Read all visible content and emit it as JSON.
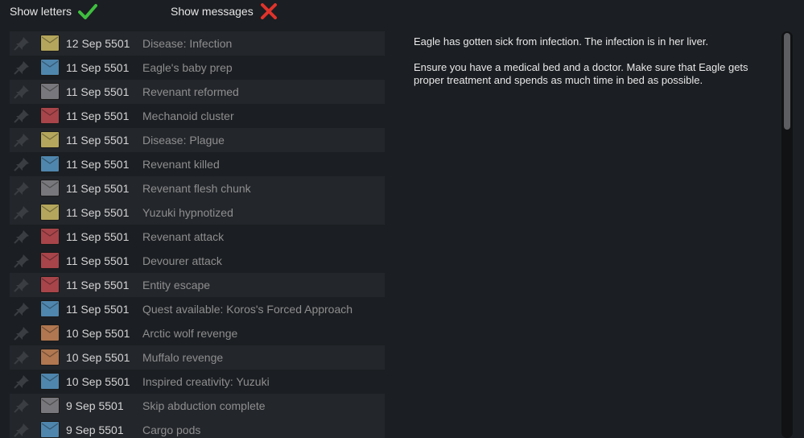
{
  "toggles": {
    "letters": {
      "label": "Show letters",
      "state": "on",
      "icon": "check-icon",
      "color": "#3fbf3f"
    },
    "messages": {
      "label": "Show messages",
      "state": "off",
      "icon": "cross-icon",
      "color": "#e0332b"
    }
  },
  "envelope_colors": {
    "yellow": "#b4a65c",
    "blue": "#4f86ad",
    "gray": "#78787c",
    "red": "#a8454a",
    "orange": "#b07750"
  },
  "letters": [
    {
      "date": "12 Sep 5501",
      "label": "Disease: Infection",
      "color": "yellow",
      "icon": "pin-icon"
    },
    {
      "date": "11 Sep 5501",
      "label": "Eagle's baby prep",
      "color": "blue",
      "icon": "pin-icon"
    },
    {
      "date": "11 Sep 5501",
      "label": "Revenant reformed",
      "color": "gray",
      "icon": "pin-icon"
    },
    {
      "date": "11 Sep 5501",
      "label": "Mechanoid cluster",
      "color": "red",
      "icon": "pin-icon"
    },
    {
      "date": "11 Sep 5501",
      "label": "Disease: Plague",
      "color": "yellow",
      "icon": "pin-icon"
    },
    {
      "date": "11 Sep 5501",
      "label": "Revenant killed",
      "color": "blue",
      "icon": "pin-icon"
    },
    {
      "date": "11 Sep 5501",
      "label": "Revenant flesh chunk",
      "color": "gray",
      "icon": "pin-icon"
    },
    {
      "date": "11 Sep 5501",
      "label": "Yuzuki hypnotized",
      "color": "yellow",
      "icon": "pin-icon"
    },
    {
      "date": "11 Sep 5501",
      "label": "Revenant attack",
      "color": "red",
      "icon": "pin-icon"
    },
    {
      "date": "11 Sep 5501",
      "label": "Devourer attack",
      "color": "red",
      "icon": "pin-icon"
    },
    {
      "date": "11 Sep 5501",
      "label": "Entity escape",
      "color": "red",
      "icon": "pin-icon"
    },
    {
      "date": "11 Sep 5501",
      "label": "Quest available: Koros's Forced Approach",
      "color": "blue",
      "icon": "pin-icon"
    },
    {
      "date": "10 Sep 5501",
      "label": "Arctic wolf revenge",
      "color": "orange",
      "icon": "pin-icon"
    },
    {
      "date": "10 Sep 5501",
      "label": "Muffalo revenge",
      "color": "orange",
      "icon": "pin-icon"
    },
    {
      "date": "10 Sep 5501",
      "label": "Inspired creativity: Yuzuki",
      "color": "blue",
      "icon": "pin-icon"
    },
    {
      "date": "9 Sep 5501",
      "label": "Skip abduction complete",
      "color": "gray",
      "icon": "pin-icon"
    },
    {
      "date": "9 Sep 5501",
      "label": "Cargo pods",
      "color": "blue",
      "icon": "pin-icon"
    }
  ],
  "detail": {
    "paragraph1": "Eagle has gotten sick from infection. The infection is in her liver.",
    "paragraph2": "Ensure you have a medical bed and a doctor. Make sure that Eagle gets proper treatment and spends as much time in bed as possible."
  }
}
